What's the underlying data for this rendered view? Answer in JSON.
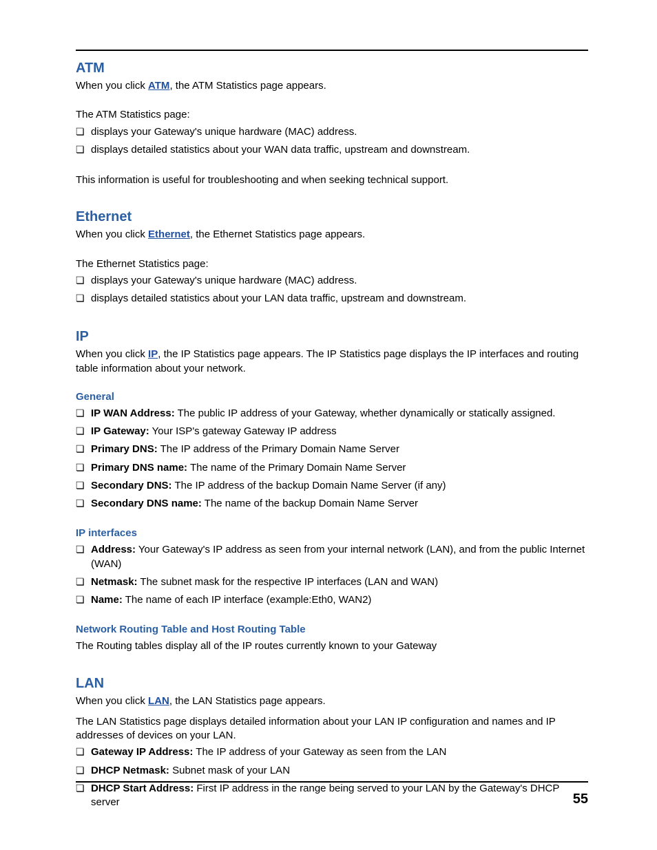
{
  "page_number": "55",
  "sections": {
    "atm": {
      "heading": "ATM",
      "intro_pre": "When you click ",
      "link": "ATM",
      "intro_post": ", the ATM Statistics page appears.",
      "lead": "The ATM Statistics page:",
      "items": [
        "displays your Gateway's unique hardware (MAC) address.",
        "displays detailed statistics about your WAN data traffic, upstream and downstream."
      ],
      "footer": "This information is useful for troubleshooting and when seeking technical support."
    },
    "ethernet": {
      "heading": "Ethernet",
      "intro_pre": "When you click ",
      "link": "Ethernet",
      "intro_post": ", the Ethernet Statistics page appears.",
      "lead": "The Ethernet Statistics page:",
      "items": [
        "displays your Gateway's unique hardware (MAC) address.",
        "displays detailed statistics about your LAN data traffic, upstream and downstream."
      ]
    },
    "ip": {
      "heading": "IP",
      "intro_pre": "When you click ",
      "link": "IP",
      "intro_post": ", the IP Statistics page appears. The IP Statistics page displays the IP interfaces and routing table information about your network.",
      "general": {
        "heading": "General",
        "items": [
          {
            "term": "IP WAN Address:",
            "def": " The public IP address of your Gateway, whether dynamically or statically assigned."
          },
          {
            "term": "IP Gateway:",
            "def": " Your ISP's gateway Gateway IP address"
          },
          {
            "term": "Primary DNS:",
            "def": " The IP address of the Primary Domain Name Server"
          },
          {
            "term": "Primary DNS name:",
            "def": " The name of the Primary Domain Name Server"
          },
          {
            "term": "Secondary DNS:",
            "def": " The IP address of the backup Domain Name Server (if any)"
          },
          {
            "term": "Secondary DNS name:",
            "def": " The name of the backup Domain Name Server"
          }
        ]
      },
      "interfaces": {
        "heading": "IP interfaces",
        "items": [
          {
            "term": "Address:",
            "def": " Your Gateway's IP address as seen from your internal network (LAN), and from the public Internet (WAN)"
          },
          {
            "term": "Netmask:",
            "def": " The subnet mask for the respective IP interfaces (LAN and WAN)"
          },
          {
            "term": "Name:",
            "def": " The name of each IP interface (example:Eth0, WAN2)"
          }
        ]
      },
      "routing": {
        "heading": "Network Routing Table and Host Routing Table",
        "body": "The Routing tables display all of the IP routes currently known to your Gateway"
      }
    },
    "lan": {
      "heading": "LAN",
      "intro_pre": "When you click ",
      "link": "LAN",
      "intro_post": ", the LAN Statistics page appears.",
      "lead": "The LAN Statistics page displays detailed information about your LAN IP configuration and names and IP addresses of devices on your LAN.",
      "items": [
        {
          "term": "Gateway IP Address:",
          "def": " The IP address of your Gateway as seen from the LAN"
        },
        {
          "term": "DHCP Netmask:",
          "def": " Subnet mask of your LAN"
        },
        {
          "term": "DHCP Start Address:",
          "def": " First IP address in the range being served to your LAN by the Gateway's DHCP server"
        }
      ]
    }
  }
}
